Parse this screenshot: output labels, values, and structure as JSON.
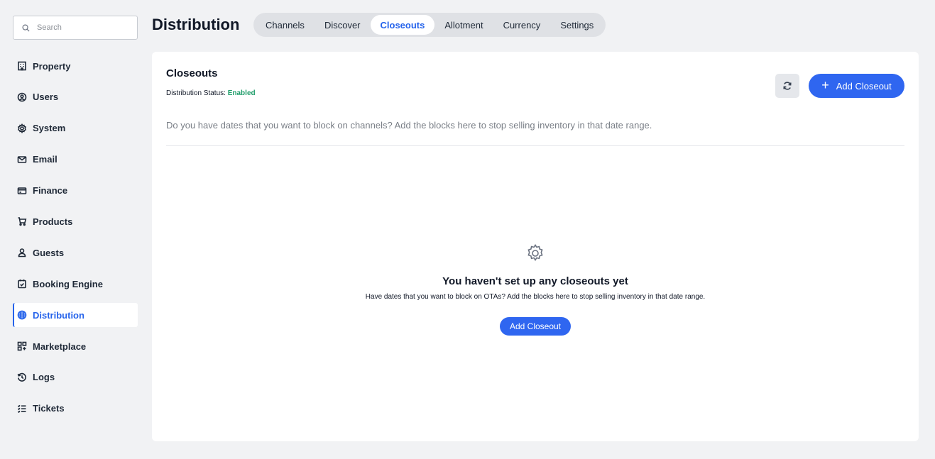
{
  "search": {
    "placeholder": "Search"
  },
  "sidebar": {
    "items": [
      {
        "label": "Property",
        "icon": "building-icon"
      },
      {
        "label": "Users",
        "icon": "user-circle-icon"
      },
      {
        "label": "System",
        "icon": "gear-icon"
      },
      {
        "label": "Email",
        "icon": "envelope-icon"
      },
      {
        "label": "Finance",
        "icon": "credit-card-icon"
      },
      {
        "label": "Products",
        "icon": "cart-icon"
      },
      {
        "label": "Guests",
        "icon": "person-icon"
      },
      {
        "label": "Booking Engine",
        "icon": "calendar-check-icon"
      },
      {
        "label": "Distribution",
        "icon": "globe-icon",
        "active": true
      },
      {
        "label": "Marketplace",
        "icon": "grid-plus-icon"
      },
      {
        "label": "Logs",
        "icon": "history-icon"
      },
      {
        "label": "Tickets",
        "icon": "checklist-icon"
      }
    ]
  },
  "header": {
    "title": "Distribution",
    "tabs": [
      {
        "label": "Channels"
      },
      {
        "label": "Discover"
      },
      {
        "label": "Closeouts",
        "active": true
      },
      {
        "label": "Allotment"
      },
      {
        "label": "Currency"
      },
      {
        "label": "Settings"
      }
    ]
  },
  "card": {
    "title": "Closeouts",
    "status_label": "Distribution Status:",
    "status_value": "Enabled",
    "add_button": "Add Closeout",
    "description": "Do you have dates that you want to block on channels? Add the blocks here to stop selling inventory in that date range."
  },
  "empty_state": {
    "title": "You haven't set up any closeouts yet",
    "text": "Have dates that you want to block on OTAs? Add the blocks here to stop selling inventory in that date range.",
    "button": "Add Closeout"
  },
  "colors": {
    "accent": "#2f66f0",
    "enabled": "#1f9d6a",
    "background": "#f1f2f4"
  }
}
